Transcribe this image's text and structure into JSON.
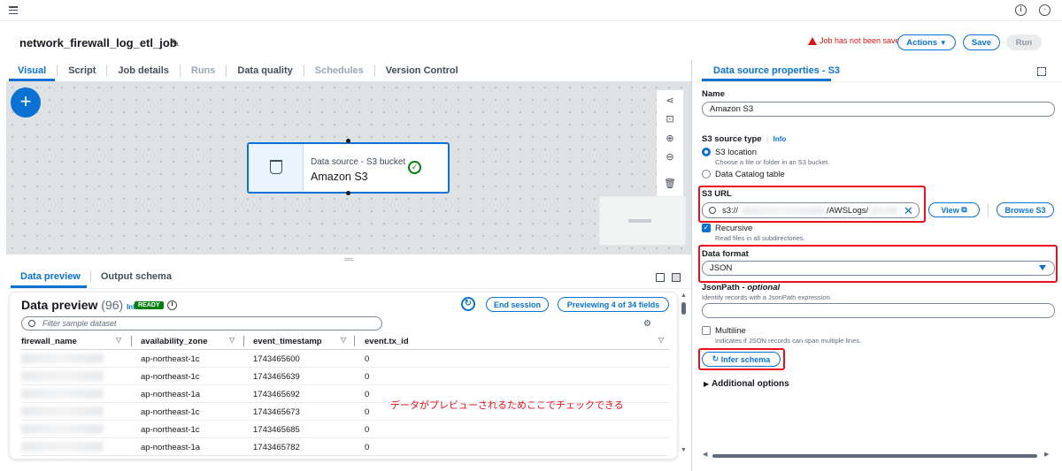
{
  "job": {
    "title": "network_firewall_log_etl_job",
    "warning": "Job has not been saved",
    "actions_label": "Actions",
    "save_label": "Save",
    "run_label": "Run"
  },
  "tabs": [
    "Visual",
    "Script",
    "Job details",
    "Runs",
    "Data quality",
    "Schedules",
    "Version Control"
  ],
  "node": {
    "type": "Data source - S3 bucket",
    "name": "Amazon S3"
  },
  "preview": {
    "tabs": [
      "Data preview",
      "Output schema"
    ],
    "title": "Data preview",
    "count": "(96)",
    "info": "Info",
    "status": "READY",
    "end_session_label": "End session",
    "previewing_label": "Previewing 4 of 34 fields",
    "filter_placeholder": "Filter sample dataset",
    "columns": [
      "firewall_name",
      "availability_zone",
      "event_timestamp",
      "event.tx_id"
    ],
    "rows": [
      {
        "zone": "ap-northeast-1c",
        "ts": "1743465600",
        "tx": "0"
      },
      {
        "zone": "ap-northeast-1c",
        "ts": "1743465639",
        "tx": "0"
      },
      {
        "zone": "ap-northeast-1a",
        "ts": "1743465692",
        "tx": "0"
      },
      {
        "zone": "ap-northeast-1c",
        "ts": "1743465673",
        "tx": "0"
      },
      {
        "zone": "ap-northeast-1c",
        "ts": "1743465685",
        "tx": "0"
      },
      {
        "zone": "ap-northeast-1a",
        "ts": "1743465782",
        "tx": "0"
      }
    ]
  },
  "annotation": "データがプレビューされるためここでチェックできる",
  "panel": {
    "title": "Data source properties - S3",
    "name_label": "Name",
    "name_value": "Amazon S3",
    "source_type_label": "S3 source type",
    "info": "Info",
    "opt_s3_location": "S3 location",
    "opt_s3_location_hint": "Choose a file or folder in an S3 bucket.",
    "opt_catalog": "Data Catalog table",
    "s3_url_label": "S3 URL",
    "s3_url_prefix": "s3://",
    "s3_url_suffix": "/AWSLogs/",
    "view_label": "View",
    "browse_label": "Browse S3",
    "recursive_label": "Recursive",
    "recursive_hint": "Read files in all subdirectories.",
    "format_label": "Data format",
    "format_value": "JSON",
    "jsonpath_label": "JsonPath - ",
    "jsonpath_optional": "optional",
    "jsonpath_hint": "Identify records with a JsonPath expression.",
    "multiline_label": "Multiline",
    "multiline_hint": "Indicates if JSON records can span multiple lines.",
    "infer_label": "Infer schema",
    "additional_label": "Additional options"
  },
  "colors": {
    "accent": "#0972d3",
    "annotation": "#e8101a",
    "success": "#037f0c"
  }
}
